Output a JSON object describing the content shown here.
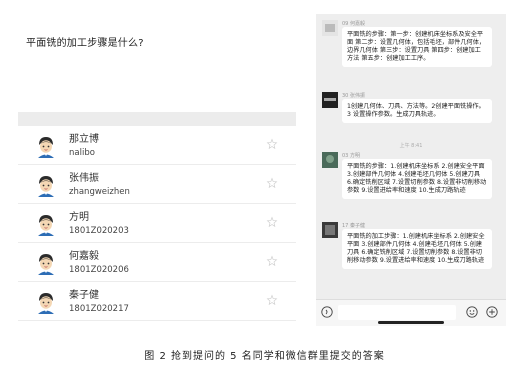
{
  "question": "平面铣的加工步骤是什么?",
  "students": [
    {
      "name": "那立博",
      "id": "nalibo"
    },
    {
      "name": "张伟振",
      "id": "zhangweizhen"
    },
    {
      "name": "方明",
      "id": "1801Z020203"
    },
    {
      "name": "何嘉毅",
      "id": "1801Z020206"
    },
    {
      "name": "秦子健",
      "id": "1801Z020217"
    }
  ],
  "chat": {
    "messages": [
      {
        "sender": "09 何嘉毅",
        "text": "平面铣的步骤：第一步：创建机床坐标系及安全平面 第二步：设置几何体，包括毛坯，部件几何体，边界几何体 第三步：设置刀具 第四步：创建加工方法 第五步：创建加工工序。"
      },
      {
        "sender": "30 张伟振",
        "text": "1创建几何体、刀具、方法等。2创建平面铣操作。3 设置操作参数。生成刀具轨迹。"
      },
      {
        "sender": "03 方明",
        "text": "平面铣的步骤：1.创建机床坐标系 2.创建安全平面 3.创建部件几何体 4.创建毛坯几何体 5.创建刀具 6.确定铣削区域 7.设置切削参数 8.设置非切削移动参数 9.设置进给率和速度 10.生成刀路轨迹"
      },
      {
        "sender": "17 秦子健",
        "text": "平面铣的加工步骤：1.创建机床坐标系 2.创建安全平面 3.创建部件几何体 4.创建毛坯几何体 5.创建刀具 6.确定铣削区域 7.设置切削参数 8.设置非切削移动参数 9.设置进给率和速度 10.生成刀路轨迹"
      }
    ],
    "time_label": "上午 8:41"
  },
  "caption": "图 2  抢到提问的 5 名同学和微信群里提交的答案"
}
